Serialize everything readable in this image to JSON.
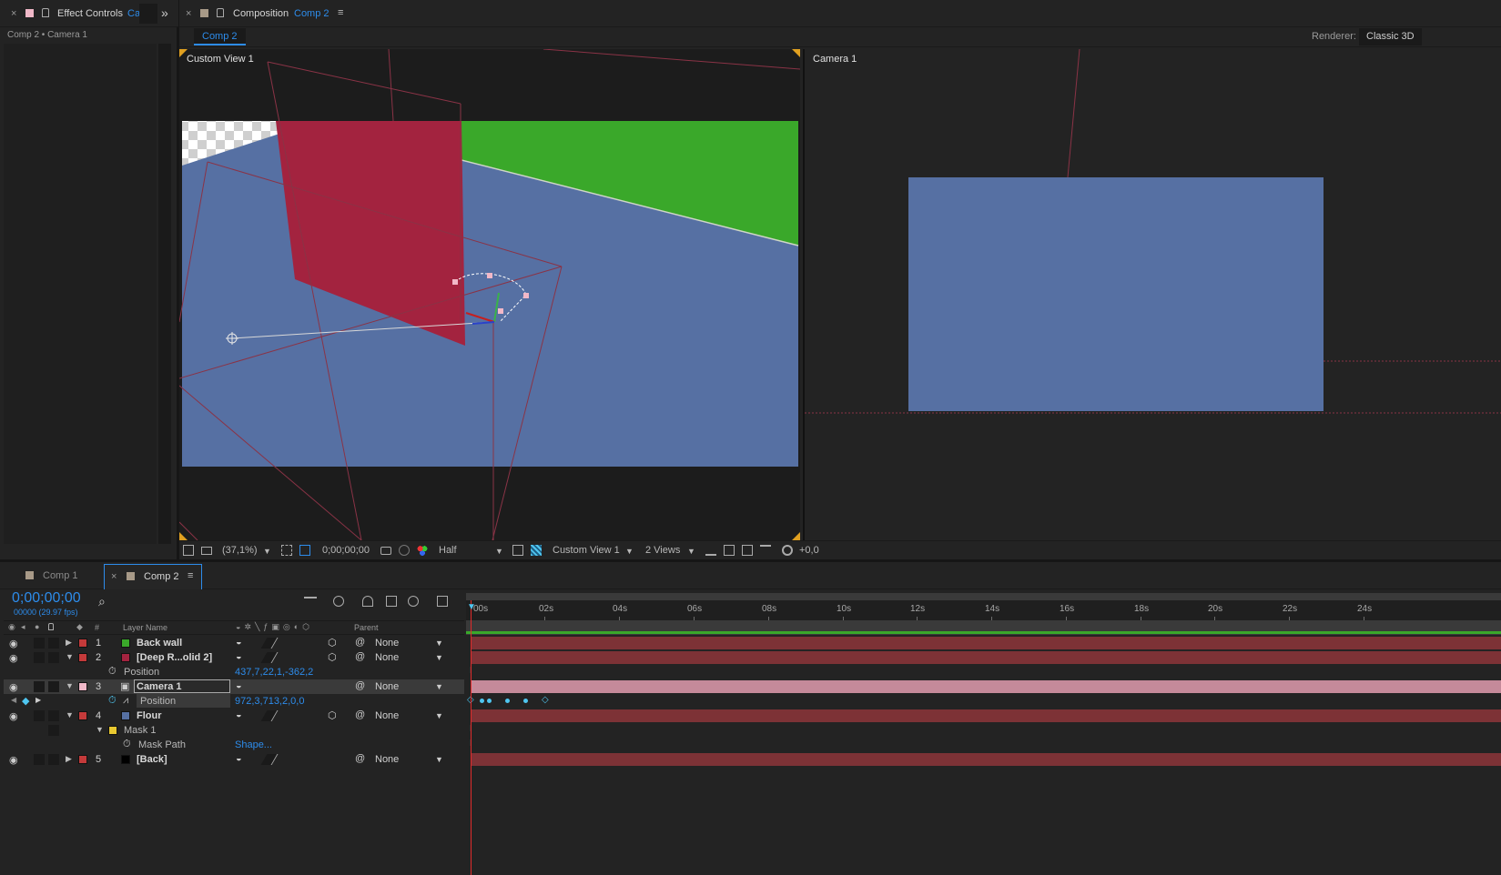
{
  "colors": {
    "accent": "#2d8ceb",
    "panel": "#232323",
    "solid_blue": "#5670a3",
    "solid_red": "#a3233f",
    "solid_green": "#3aa82a",
    "timeline_bar_red": "#7d3236",
    "camera_bar_pink": "#c58a9a",
    "playhead": "#e22b2b"
  },
  "effect_controls": {
    "tab_title": "Effect Controls",
    "tab_target": "Ca",
    "breadcrumb": "Comp 2 • Camera 1",
    "close": "×",
    "overflow": "»"
  },
  "composition": {
    "tab_title": "Composition",
    "tab_target": "Comp 2",
    "close": "×",
    "menu": "≡",
    "comp_chip": "Comp 2",
    "renderer_label": "Renderer:",
    "renderer_value": "Classic 3D",
    "left_view_label": "Custom View 1",
    "right_view_label": "Camera 1"
  },
  "viewer_toolbar": {
    "zoom": "(37,1%)",
    "timecode": "0;00;00;00",
    "resolution": "Half",
    "view": "Custom View 1",
    "layout": "2 Views",
    "exposure": "+0,0"
  },
  "timeline": {
    "tabs": [
      {
        "label": "Comp 1",
        "active": false
      },
      {
        "label": "Comp 2",
        "active": true
      }
    ],
    "tab_close": "×",
    "tab_menu": "≡",
    "current_time": "0;00;00;00",
    "frame_info": "00000 (29.97 fps)",
    "search_glyph": "⌕",
    "columns": {
      "num": "#",
      "layer_name": "Layer Name",
      "parent": "Parent"
    },
    "ruler": [
      "00s",
      "02s",
      "04s",
      "06s",
      "08s",
      "10s",
      "12s",
      "14s",
      "16s",
      "18s",
      "20s",
      "22s",
      "24s"
    ],
    "layers": [
      {
        "num": "1",
        "name": "Back wall",
        "color": "#3aa82a",
        "parent": "None",
        "twirl": "▶"
      },
      {
        "num": "2",
        "name": "[Deep R...olid 2]",
        "color": "#a3233f",
        "parent": "None",
        "twirl": "▼"
      },
      {
        "num": "3",
        "name": "Camera 1",
        "color": "#c58a9a",
        "parent": "None",
        "twirl": "▼"
      },
      {
        "num": "4",
        "name": "Flour",
        "color": "#5670a3",
        "parent": "None",
        "twirl": "▼"
      },
      {
        "num": "5",
        "name": "[Back]",
        "color": "#000000",
        "parent": "None",
        "twirl": "▶"
      }
    ],
    "props": {
      "layer2_position_label": "Position",
      "layer2_position_value": "437,7,22,1,-362,2",
      "camera_position_label": "Position",
      "camera_position_value": "972,3,713,2,0,0",
      "mask_label": "Mask 1",
      "mask_path_label": "Mask Path",
      "mask_path_value": "Shape..."
    }
  }
}
